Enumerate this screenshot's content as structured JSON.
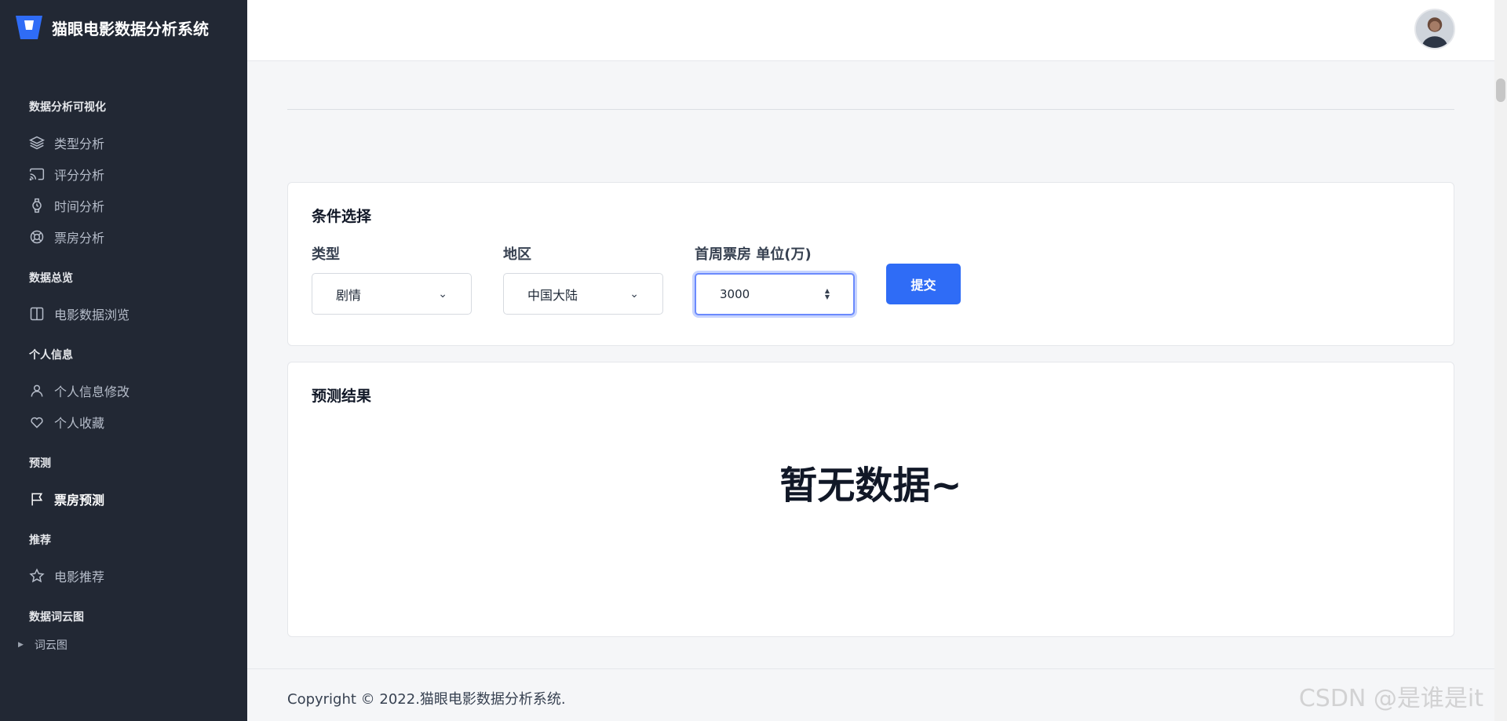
{
  "app": {
    "title": "猫眼电影数据分析系统"
  },
  "sidebar": {
    "groups": [
      {
        "heading": "数据分析可视化",
        "items": [
          {
            "label": "类型分析",
            "icon": "layers-icon"
          },
          {
            "label": "评分分析",
            "icon": "cast-icon"
          },
          {
            "label": "时间分析",
            "icon": "watch-icon"
          },
          {
            "label": "票房分析",
            "icon": "lifebuoy-icon"
          }
        ]
      },
      {
        "heading": "数据总览",
        "items": [
          {
            "label": "电影数据浏览",
            "icon": "columns-icon"
          }
        ]
      },
      {
        "heading": "个人信息",
        "items": [
          {
            "label": "个人信息修改",
            "icon": "user-icon"
          },
          {
            "label": "个人收藏",
            "icon": "heart-icon"
          }
        ]
      },
      {
        "heading": "预测",
        "items": [
          {
            "label": "票房预测",
            "icon": "flag-icon",
            "active": true
          }
        ]
      },
      {
        "heading": "推荐",
        "items": [
          {
            "label": "电影推荐",
            "icon": "star-icon"
          }
        ]
      },
      {
        "heading": "数据词云图",
        "items": [
          {
            "label": "词云图",
            "icon": "caret-right-icon"
          }
        ]
      }
    ]
  },
  "filter": {
    "title": "条件选择",
    "type": {
      "label": "类型",
      "value": "剧情"
    },
    "region": {
      "label": "地区",
      "value": "中国大陆"
    },
    "box_office": {
      "label": "首周票房 单位(万)",
      "value": "3000"
    },
    "submit_label": "提交"
  },
  "result": {
    "title": "预测结果",
    "empty_text": "暂无数据~"
  },
  "footer": {
    "copyright": "Copyright © 2022.猫眼电影数据分析系统.",
    "watermark": "CSDN @是谁是it"
  },
  "colors": {
    "sidebar_bg": "#222834",
    "primary": "#2f6cf6",
    "page_bg": "#f5f6f8"
  }
}
